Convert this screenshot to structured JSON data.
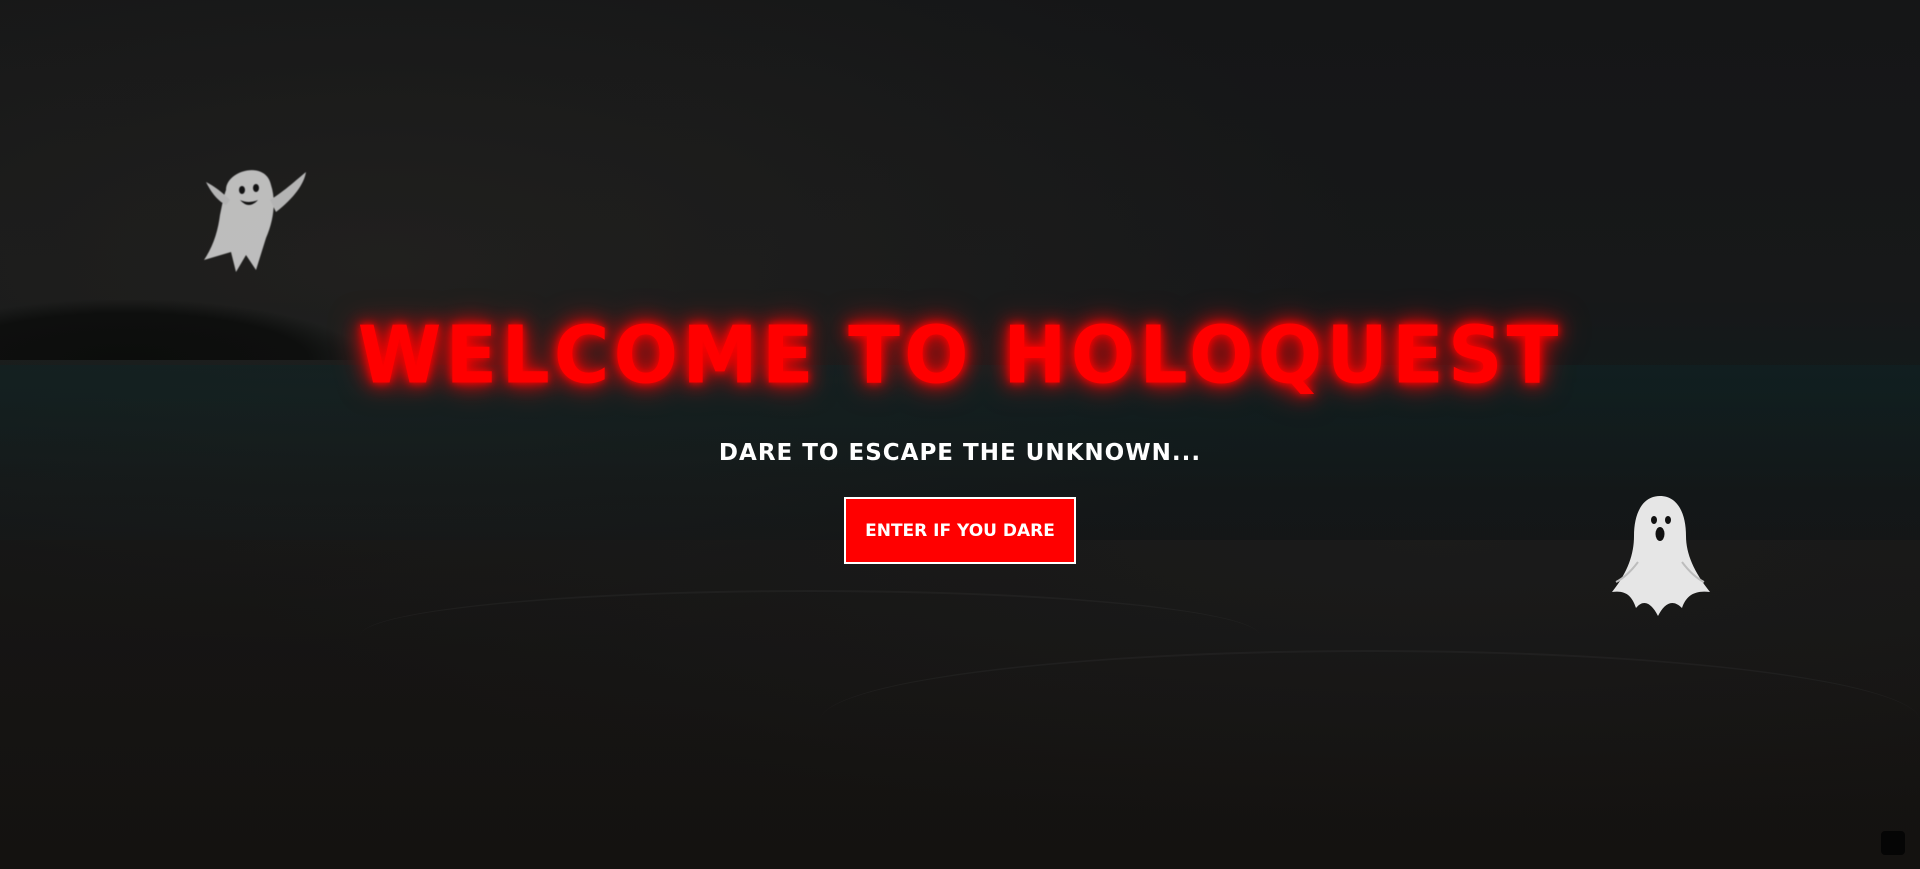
{
  "hero": {
    "title": "WELCOME TO HOLOQUEST",
    "subtitle": "DARE TO ESCAPE THE UNKNOWN...",
    "cta_label": "ENTER IF YOU DARE"
  },
  "colors": {
    "accent": "#ff0000",
    "background": "#141516",
    "text": "#ffffff"
  },
  "icons": [
    "ghost-icon",
    "ghost-icon"
  ]
}
